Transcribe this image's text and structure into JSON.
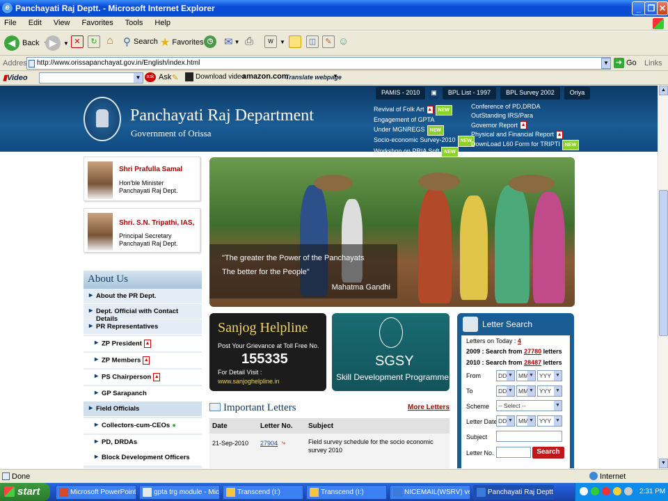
{
  "window": {
    "title": "Panchayati Raj Deptt. - Microsoft Internet Explorer"
  },
  "menu": [
    "File",
    "Edit",
    "View",
    "Favorites",
    "Tools",
    "Help"
  ],
  "toolbar": {
    "back": "Back",
    "search": "Search",
    "favorites": "Favorites"
  },
  "address": {
    "label": "Address",
    "url": "http://www.orissapanchayat.gov.in/English/index.html",
    "go": "Go",
    "links": "Links"
  },
  "videobar": {
    "video": "Video",
    "ask": "Ask",
    "download": "Download video",
    "amazon": "amazon.com",
    "translate": "Translate webpage"
  },
  "site": {
    "top_links": [
      "PAMIS - 2010",
      "BPL List - 1997",
      "BPL Survey 2002",
      "Oriya"
    ],
    "dept_name": "Panchayati Raj Department",
    "govt": "Government of Orissa",
    "news_left": [
      "Revival of Folk Art",
      "Engagement of GPTA",
      "Under MGNREGS",
      "Socio-economic Survey-2010",
      "Workshop on PRIA Soft"
    ],
    "news_right": [
      "Conference of PD,DRDA",
      "OutStanding IRS/Para",
      "Governor Report",
      "Physical and Financial Report",
      "DownLoad L60 Form for TRIPTI"
    ],
    "new_badge": "NEW",
    "minister1": {
      "name": "Shri Prafulla Samal",
      "line1": "Hon'ble Minister",
      "line2": "Panchayati Raj Dept."
    },
    "minister2": {
      "name": "Shri. S.N. Tripathi, IAS,",
      "line1": "Principal Secretary",
      "line2": "Panchayati Raj Dept."
    },
    "about": {
      "title": "About Us",
      "items": [
        "About the PR Dept.",
        "Dept. Official with Contact Details",
        "PR Representatives",
        "ZP President",
        "ZP Members",
        "PS Chairperson",
        "GP Sarapanch",
        "Field Officials",
        "Collectors-cum-CEOs",
        "PD, DRDAs",
        "Block Development Officers"
      ]
    },
    "quote": {
      "line1": "\"The greater the Power of the Panchayats",
      "line2": "The better for the People\"",
      "author": "Mahatma Gandhi"
    },
    "sanjog": {
      "title": "Sanjog Helpline",
      "grievance": "Post Your Grievance at Toll Free No.",
      "number": "155335",
      "detail": "For Detail Visit :",
      "url": "www.sanjoghelpline.in"
    },
    "sgsy": {
      "title": "SGSY",
      "subtitle": "Skill Development Programme"
    },
    "letters": {
      "title": "Important Letters",
      "more": "More Letters",
      "headers": [
        "Date",
        "Letter No.",
        "Subject"
      ],
      "rows": [
        {
          "date": "21-Sep-2010",
          "no": "27904",
          "subject": "Field survey schedule for the socio economic survey 2010"
        }
      ]
    },
    "search": {
      "title": "Letter Search",
      "today_label": "Letters on Today :",
      "today_count": "4",
      "y2009_label": "2009 : Search from",
      "y2009_count": "27780",
      "y2010_label": "2010 : Search from",
      "y2010_count": "28487",
      "letters_word": "letters",
      "from": "From",
      "to": "To",
      "scheme": "Scheme",
      "letter_date": "Letter Date",
      "subject": "Subject",
      "letter_no": "Letter No.",
      "dd": "DD",
      "mm": "MM",
      "yyyy": "YYY",
      "select": "-- Select --",
      "button": "Search"
    }
  },
  "statusbar": {
    "status": "Done",
    "zone": "Internet"
  },
  "taskbar": {
    "start": "start",
    "tasks": [
      "Microsoft PowerPoint ...",
      "gpta trg module - Mic...",
      "Transcend (I:)",
      "Transcend (I:)",
      "NICEMAIL(WSRV) ver...",
      "Panchayati Raj Deptt. ..."
    ],
    "clock": "2:31 PM"
  }
}
